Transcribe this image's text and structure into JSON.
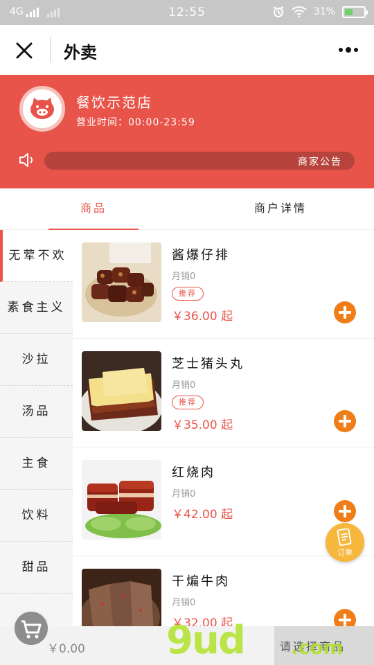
{
  "status_bar": {
    "network": "4G",
    "time": "12:55",
    "battery": "31%"
  },
  "nav": {
    "title": "外卖"
  },
  "shop": {
    "name": "餐饮示范店",
    "hours": "营业时间：00:00-23:59",
    "notice_label": "商家公告"
  },
  "tabs": {
    "goods": "商品",
    "detail": "商户详情"
  },
  "categories": [
    "无荤不欢",
    "素食主义",
    "沙拉",
    "汤品",
    "主食",
    "饮料",
    "甜品"
  ],
  "items": [
    {
      "name": "酱爆仔排",
      "sales": "月销0",
      "tag": "推荐",
      "price": "￥36.00 起"
    },
    {
      "name": "芝士猪头丸",
      "sales": "月销0",
      "tag": "推荐",
      "price": "￥35.00 起"
    },
    {
      "name": "红烧肉",
      "sales": "月销0",
      "price": "￥42.00 起"
    },
    {
      "name": "干煸牛肉",
      "sales": "月销0",
      "price": "￥32.00 起"
    }
  ],
  "order_float": {
    "label": "订单"
  },
  "bottom": {
    "total": "￥0.00",
    "checkout": "请选择商品"
  },
  "watermark": {
    "main": "9ud",
    "suffix": ".com"
  },
  "colors": {
    "brand": "#e8544a",
    "add_button": "#f07e18",
    "order_float": "#f6b73c"
  }
}
